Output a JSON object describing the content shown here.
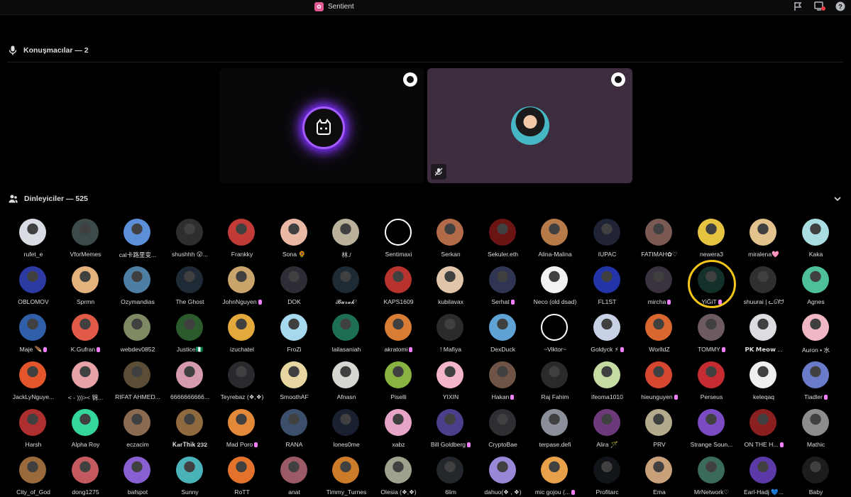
{
  "titlebar": {
    "app_name": "Sentient"
  },
  "speakers": {
    "header": "Konuşmacılar — 2"
  },
  "listeners": {
    "header": "Dinleyiciler — 525",
    "rows": [
      [
        {
          "name": "rufet_e",
          "color": "#d9dde3"
        },
        {
          "name": "VforMemes",
          "color": "#3c4a4a"
        },
        {
          "name": "cal卡路里变...",
          "color": "#5b8fd8"
        },
        {
          "name": "shushhh 😮...",
          "color": "#2e2e30"
        },
        {
          "name": "Frankky",
          "color": "#c23b37"
        },
        {
          "name": "Sona 🌻",
          "color": "#e9b9a6"
        },
        {
          "name": "林./",
          "color": "#b9b19a"
        },
        {
          "name": "Sentimaxi",
          "color": "#000000"
        },
        {
          "name": "Serkan",
          "color": "#b26a48"
        },
        {
          "name": "Sekuler.eth",
          "color": "#6b1414"
        },
        {
          "name": "Alina-Malina",
          "color": "#b67b49"
        },
        {
          "name": "IUPAC",
          "color": "#1f2333"
        },
        {
          "name": "FATIMAH✿♡",
          "color": "#7a5a52"
        },
        {
          "name": "newera3",
          "color": "#e6c341"
        },
        {
          "name": "miralena🩷",
          "color": "#e3c28d"
        },
        {
          "name": "Kaka",
          "color": "#a9dde2"
        }
      ],
      [
        {
          "name": "OBLOMOV",
          "color": "#2c3aa1"
        },
        {
          "name": "Sprmn",
          "color": "#e4b27c"
        },
        {
          "name": "Ozymandias",
          "color": "#4d7fa5"
        },
        {
          "name": "The Ghost",
          "color": "#1f2a37"
        },
        {
          "name": "JohnNguyen",
          "color": "#c9a56b",
          "boost": true
        },
        {
          "name": "DOK",
          "color": "#2d2d35"
        },
        {
          "name": "𝓑𝓾𝓻𝓪𝓴⁷",
          "color": "#1e2b34"
        },
        {
          "name": "KAPS1609",
          "color": "#b8332d"
        },
        {
          "name": "kubilavax",
          "color": "#e0c5aa"
        },
        {
          "name": "Serhat",
          "color": "#2f3552",
          "boost": true
        },
        {
          "name": "Neco (old dsad)",
          "color": "#f2f2f2"
        },
        {
          "name": "FL1ST",
          "color": "#2234a7"
        },
        {
          "name": "mircha",
          "color": "#3b3240",
          "boost": true
        },
        {
          "name": "YiĞiT",
          "color": "#14302a",
          "boost": true
        },
        {
          "name": "shuurai | ᓚᘏᗢ",
          "color": "#2d2f31"
        },
        {
          "name": "Agnes",
          "color": "#4dbf9a"
        }
      ],
      [
        {
          "name": "Maje 🪶",
          "color": "#2f5fa8",
          "boost": true
        },
        {
          "name": "K.Gufran",
          "color": "#e05a47",
          "boost": true
        },
        {
          "name": "webdev0852",
          "color": "#7d8a64"
        },
        {
          "name": "Justice🇳🇬",
          "color": "#2b5b2c"
        },
        {
          "name": "izuchatel",
          "color": "#e3a93c"
        },
        {
          "name": "FroZi",
          "color": "#a7d9ee"
        },
        {
          "name": "lailasaniah",
          "color": "#1d6f52"
        },
        {
          "name": "akratomi",
          "color": "#d97d35",
          "boost": true
        },
        {
          "name": "! Mafiya",
          "color": "#2b2b2b"
        },
        {
          "name": "DexDuck",
          "color": "#5fa3d4"
        },
        {
          "name": "~Viktor~",
          "color": "#000000"
        },
        {
          "name": "Goldyck ⚡",
          "color": "#c8d1e6",
          "boost": true
        },
        {
          "name": "WorlldZ",
          "color": "#d7662f"
        },
        {
          "name": "TOMMY",
          "color": "#6e5a62",
          "boost": true
        },
        {
          "name": "𝗣𝗞 𝗠𝗲𝗼𝘄 ...",
          "color": "#dcdde0"
        },
        {
          "name": "Auron • 水",
          "color": "#f2b7c4"
        }
      ],
      [
        {
          "name": "JackLyNguye...",
          "color": "#e3552a"
        },
        {
          "name": "< - )))>< 锦...",
          "color": "#e8a3a8"
        },
        {
          "name": "RIFAT AHMED...",
          "color": "#5c4e36"
        },
        {
          "name": "6666666666...",
          "color": "#d59ab0"
        },
        {
          "name": "Teyrebaz (❖,❖)",
          "color": "#2a2a2e"
        },
        {
          "name": "SmoothAF",
          "color": "#e8d6a2"
        },
        {
          "name": "Afnasn",
          "color": "#d8d6d0"
        },
        {
          "name": "Piselli",
          "color": "#89b340"
        },
        {
          "name": "YIXIN",
          "color": "#f3b5c8"
        },
        {
          "name": "Hakan",
          "color": "#6d5446",
          "boost": true
        },
        {
          "name": "Raj Fahim",
          "color": "#2a2a2a"
        },
        {
          "name": "ifeoma1010",
          "color": "#c5dba2"
        },
        {
          "name": "hieunguyen",
          "color": "#d7472f",
          "boost": true
        },
        {
          "name": "Perseus",
          "color": "#c52c32"
        },
        {
          "name": "keleqaq",
          "color": "#efeff1"
        },
        {
          "name": "Tiadler",
          "color": "#6a7cc9",
          "boost": true
        }
      ],
      [
        {
          "name": "Harsh",
          "color": "#ae2f2f"
        },
        {
          "name": "Alpha Roy",
          "color": "#35d69c"
        },
        {
          "name": "eczacim",
          "color": "#8a6b52"
        },
        {
          "name": "𝐊𝐚𝐫𝐓𝐡𝐢𝐤 𝟐𝟑𝟐",
          "color": "#8f6a3e"
        },
        {
          "name": "Mad Poro",
          "color": "#e3893a",
          "boost": true
        },
        {
          "name": "RANA",
          "color": "#3b4f6b"
        },
        {
          "name": "lones0me",
          "color": "#1a2030"
        },
        {
          "name": "xabz",
          "color": "#e6a4c6"
        },
        {
          "name": "Bill Goldberg",
          "color": "#4a3f8a",
          "boost": true
        },
        {
          "name": "CryptoBae",
          "color": "#2f2f33"
        },
        {
          "name": "terpase.defi",
          "color": "#8b8f99"
        },
        {
          "name": "Alira 🪄",
          "color": "#6c3a7a"
        },
        {
          "name": "PRV",
          "color": "#b3a98c"
        },
        {
          "name": "Strange Soun...",
          "color": "#7b4bc1"
        },
        {
          "name": "ON THE H...",
          "color": "#8a1f1f",
          "boost": true
        },
        {
          "name": "Mathic",
          "color": "#8c8c8c"
        }
      ],
      [
        {
          "name": "City_of_God",
          "color": "#9b6a3a"
        },
        {
          "name": "dong1275",
          "color": "#c45a5f"
        },
        {
          "name": "bafspot",
          "color": "#8a5fd1"
        },
        {
          "name": "Sunny",
          "color": "#4ab3b9"
        },
        {
          "name": "RoTT",
          "color": "#e3722d"
        },
        {
          "name": "anat",
          "color": "#9c5a66"
        },
        {
          "name": "Timmy_Turnes",
          "color": "#cc7b29"
        },
        {
          "name": "Olesia (❖,❖)",
          "color": "#9ea28c"
        },
        {
          "name": "6lim",
          "color": "#23262b"
        },
        {
          "name": "dahuo(❖ , ❖)",
          "color": "#9988d8"
        },
        {
          "name": "mic gojou (...",
          "color": "#e8a14a",
          "boost": true
        },
        {
          "name": "Profitarc",
          "color": "#111418"
        },
        {
          "name": "Ema",
          "color": "#c8a07a"
        },
        {
          "name": "MrNetwork♡",
          "color": "#3a6a5a"
        },
        {
          "name": "Earl-Hadj 💙...",
          "color": "#5b3aa8"
        },
        {
          "name": "Baby",
          "color": "#1c1c1c"
        }
      ]
    ]
  }
}
